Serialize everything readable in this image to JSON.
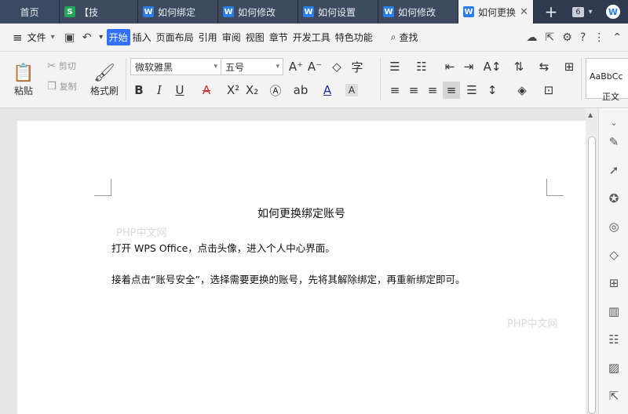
{
  "tabs": {
    "home": "首页",
    "items": [
      {
        "label": "【技",
        "icon": "S"
      },
      {
        "label": "如何绑定",
        "icon": "W"
      },
      {
        "label": "如何修改",
        "icon": "W"
      },
      {
        "label": "如何设置",
        "icon": "W"
      },
      {
        "label": "如何修改",
        "icon": "W"
      },
      {
        "label": "如何更换",
        "icon": "W"
      }
    ],
    "count": "6"
  },
  "menu": {
    "file": "文件",
    "items": [
      "开始",
      "插入",
      "页面布局",
      "引用",
      "审阅",
      "视图",
      "章节",
      "开发工具",
      "特色功能"
    ],
    "search": "查找"
  },
  "ribbon": {
    "paste": "粘贴",
    "cut": "剪切",
    "copy": "复制",
    "format_painter": "格式刷",
    "font_name": "微软雅黑",
    "font_size": "五号",
    "style_preview": "AaBbCc",
    "style_name": "正文"
  },
  "document": {
    "title": "如何更换绑定账号",
    "paragraphs": [
      "打开 WPS Office，点击头像，进入个人中心界面。",
      "接着点击“账号安全”，选择需要更换的账号，先将其解除绑定，再重新绑定即可。"
    ],
    "watermark": "PHP中文网"
  },
  "colors": {
    "tabbar": "#2f3a4e",
    "accent": "#3370ff",
    "wps_blue": "#2b7de9"
  }
}
